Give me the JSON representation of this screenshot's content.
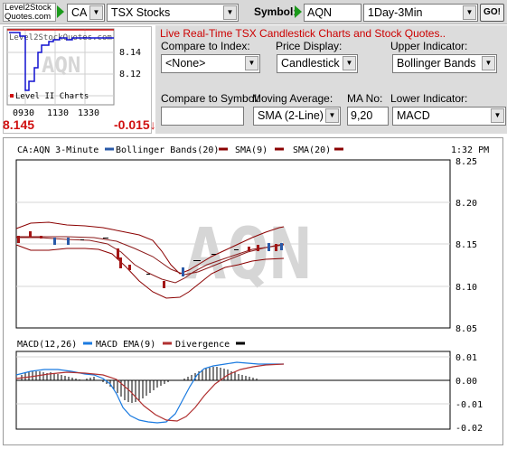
{
  "topbar": {
    "logo_line1": "Level2Stock",
    "logo_line2": "Quotes.com",
    "country": "CA",
    "market": "TSX Stocks",
    "symbol_label": "Symbol:",
    "symbol_value": "AQN",
    "timeframe": "1Day-3Min",
    "go_label": "GO!"
  },
  "mini_chart": {
    "watermark": "AQN",
    "site_text": "Level2StockQuotes.com",
    "legend_text": "Level II Charts",
    "y_ticks": [
      "8.14",
      "8.12"
    ],
    "x_ticks": [
      "0930",
      "1130",
      "1330"
    ],
    "price": "8.145",
    "change": "-0.015",
    "change_arrow": "↓",
    "colors": {
      "line": "#1010d0",
      "ref_line": "#d01010"
    }
  },
  "controls": {
    "live_text": "Live Real-Time TSX Candlestick Charts and Stock Quotes..",
    "compare_index_label": "Compare to Index:",
    "compare_index_value": "<None>",
    "price_display_label": "Price Display:",
    "price_display_value": "Candlestick",
    "upper_indicator_label": "Upper Indicator:",
    "upper_indicator_value": "Bollinger Bands",
    "compare_symbol_label": "Compare to Symbol:",
    "compare_symbol_value": "",
    "moving_average_label": "Moving Average:",
    "moving_average_value": "SMA (2-Line)",
    "ma_no_label": "MA No:",
    "ma_no_value": "9,20",
    "lower_indicator_label": "Lower Indicator:",
    "lower_indicator_value": "MACD"
  },
  "main_chart": {
    "title": "CA:AQN 3-Minute",
    "legend": [
      "Bollinger Bands(20)",
      "SMA(9)",
      "SMA(20)"
    ],
    "time": "1:32 PM",
    "watermark": "AQN",
    "price_ticks": [
      "8.25",
      "8.20",
      "8.15",
      "8.10",
      "8.05"
    ],
    "macd_legend": [
      "MACD(12,26)",
      "MACD EMA(9)",
      "Divergence"
    ],
    "macd_ticks": [
      "0.01",
      "0.00",
      "-0.01",
      "-0.02"
    ],
    "colors": {
      "band": "#8b0000",
      "sma": "#8b1a1a",
      "candle_down": "#a31515",
      "candle_up": "#2a5aa8",
      "macd": "#1a7ae0",
      "macd_ema": "#b03030",
      "divergence": "#000000",
      "watermark": "#d6d6d6"
    }
  }
}
